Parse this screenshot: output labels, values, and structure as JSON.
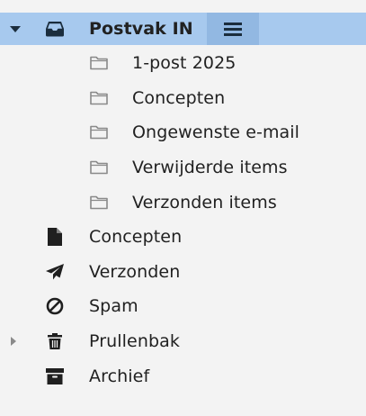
{
  "tree": {
    "inbox": {
      "label": "Postvak IN",
      "icon": "inbox-icon",
      "expanded": true
    },
    "subfolders": [
      {
        "label": "1-post 2025",
        "icon": "folder-outline-icon"
      },
      {
        "label": "Concepten",
        "icon": "folder-outline-icon"
      },
      {
        "label": "Ongewenste e-mail",
        "icon": "folder-outline-icon"
      },
      {
        "label": "Verwijderde items",
        "icon": "folder-outline-icon"
      },
      {
        "label": "Verzonden items",
        "icon": "folder-outline-icon"
      }
    ],
    "folders": [
      {
        "label": "Concepten",
        "icon": "file-icon"
      },
      {
        "label": "Verzonden",
        "icon": "paper-plane-icon"
      },
      {
        "label": "Spam",
        "icon": "ban-icon"
      },
      {
        "label": "Prullenbak",
        "icon": "trash-icon",
        "collapsible": true
      },
      {
        "label": "Archief",
        "icon": "archive-box-icon"
      }
    ]
  },
  "colors": {
    "selected_row": "#a7c9ee",
    "menu_button": "#92b8e2",
    "background": "#f3f3f3",
    "icon": "#1f1f1f",
    "folder_outline": "#8a8a8a"
  }
}
